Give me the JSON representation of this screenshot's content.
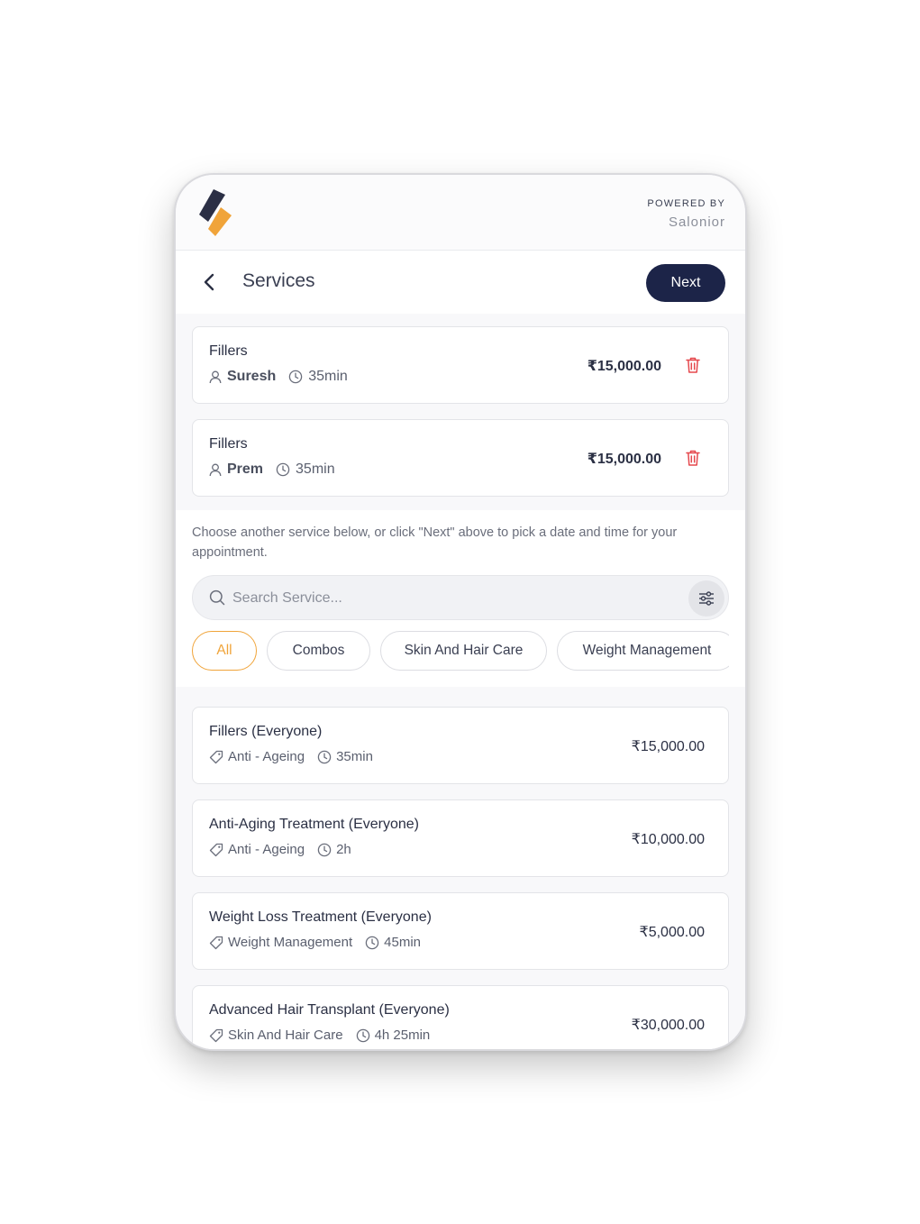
{
  "brand": {
    "powered_by": "POWERED BY",
    "name": "Salonior",
    "colors": {
      "dark": "#2b2f45",
      "accent": "#f0a43a"
    }
  },
  "header": {
    "title": "Services",
    "next_label": "Next"
  },
  "selected_services": [
    {
      "name": "Fillers",
      "staff": "Suresh",
      "duration": "35min",
      "price": "₹15,000.00"
    },
    {
      "name": "Fillers",
      "staff": "Prem",
      "duration": "35min",
      "price": "₹15,000.00"
    }
  ],
  "hint": "Choose another service below, or click \"Next\" above to pick a date and time for your appointment.",
  "search": {
    "placeholder": "Search Service..."
  },
  "categories": [
    {
      "label": "All",
      "active": true
    },
    {
      "label": "Combos",
      "active": false
    },
    {
      "label": "Skin And Hair Care",
      "active": false
    },
    {
      "label": "Weight Management",
      "active": false
    }
  ],
  "services": [
    {
      "name": "Fillers (Everyone)",
      "category": "Anti - Ageing",
      "duration": "35min",
      "price": "₹15,000.00"
    },
    {
      "name": "Anti-Aging Treatment (Everyone)",
      "category": "Anti - Ageing",
      "duration": "2h",
      "price": "₹10,000.00"
    },
    {
      "name": "Weight Loss Treatment (Everyone)",
      "category": "Weight Management",
      "duration": "45min",
      "price": "₹5,000.00"
    },
    {
      "name": "Advanced Hair Transplant (Everyone)",
      "category": "Skin And Hair Care",
      "duration": "4h 25min",
      "price": "₹30,000.00"
    }
  ],
  "icons": {
    "back": "chevron-left-icon",
    "staff": "user-icon",
    "duration": "clock-icon",
    "delete": "trash-icon",
    "category": "tag-icon",
    "search": "search-icon",
    "filter": "sliders-icon"
  }
}
